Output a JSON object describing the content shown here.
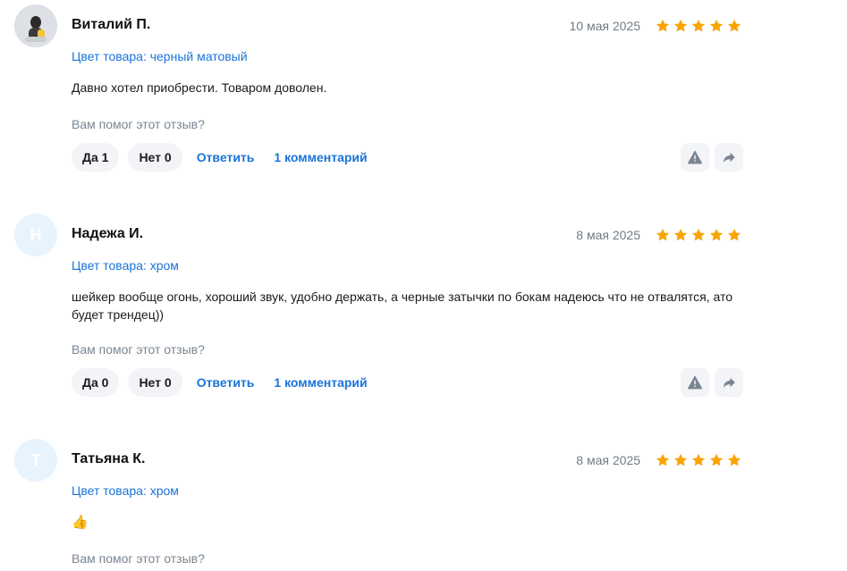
{
  "reviews": [
    {
      "author": "Виталий П.",
      "avatar_letter": "",
      "date": "10 мая 2025",
      "rating": 5,
      "variant": "Цвет товара: черный матовый",
      "text": "Давно хотел приобрести. Товаром доволен.",
      "helpful_question": "Вам помог этот отзыв?",
      "yes_label": "Да 1",
      "no_label": "Нет 0",
      "reply_label": "Ответить",
      "comments_label": "1 комментарий"
    },
    {
      "author": "Надежа И.",
      "avatar_letter": "Н",
      "date": "8 мая 2025",
      "rating": 5,
      "variant": "Цвет товара: хром",
      "text": "шейкер вообще огонь, хороший звук, удобно держать, а черные затычки по бокам надеюсь что не отвалятся, ато будет трендец))",
      "helpful_question": "Вам помог этот отзыв?",
      "yes_label": "Да 0",
      "no_label": "Нет 0",
      "reply_label": "Ответить",
      "comments_label": "1 комментарий"
    },
    {
      "author": "Татьяна К.",
      "avatar_letter": "Т",
      "date": "8 мая 2025",
      "rating": 5,
      "variant": "Цвет товара: хром",
      "text": "👍",
      "helpful_question": "Вам помог этот отзыв?"
    }
  ],
  "colors": {
    "star": "#f9a400",
    "link": "#1a73d9",
    "pill_bg": "#f2f4f7",
    "avatar_bg": "#e7f3fd"
  }
}
